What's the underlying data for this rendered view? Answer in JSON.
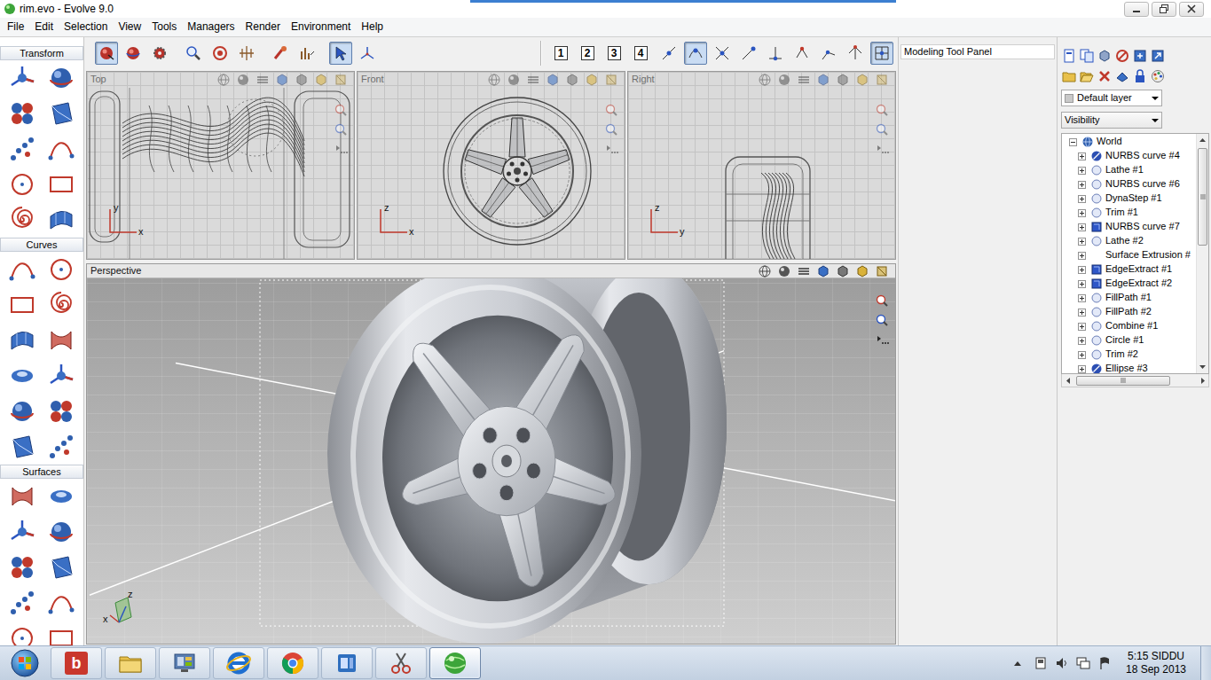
{
  "window": {
    "title": "rim.evo - Evolve 9.0"
  },
  "menu": [
    "File",
    "Edit",
    "Selection",
    "View",
    "Tools",
    "Managers",
    "Render",
    "Environment",
    "Help"
  ],
  "toolbar": {
    "tools": [
      {
        "selected": true
      },
      {
        "selected": false
      },
      {
        "selected": false
      },
      {
        "selected": false
      },
      {
        "selected": false
      },
      {
        "selected": false
      },
      {
        "selected": false
      },
      {
        "selected": false
      },
      {
        "selected": true
      },
      {
        "selected": false
      }
    ],
    "layouts": [
      {
        "label": "1",
        "selected": false
      },
      {
        "label": "2",
        "selected": false
      },
      {
        "label": "3",
        "selected": false
      },
      {
        "label": "4",
        "selected": false
      }
    ],
    "snaps": [
      {
        "selected": false
      },
      {
        "selected": true
      },
      {
        "selected": false
      },
      {
        "selected": false
      },
      {
        "selected": false
      },
      {
        "selected": false
      },
      {
        "selected": false
      },
      {
        "selected": false
      },
      {
        "selected": true
      }
    ]
  },
  "palette": [
    {
      "title": "Transform"
    },
    {
      "title": "Curves"
    },
    {
      "title": "Surfaces"
    }
  ],
  "viewports": [
    {
      "label": "Top",
      "axes": [
        "y",
        "x"
      ]
    },
    {
      "label": "Front",
      "axes": [
        "z",
        "x"
      ]
    },
    {
      "label": "Right",
      "axes": [
        "z",
        "y"
      ]
    },
    {
      "label": "Perspective",
      "axes": [
        "z",
        "x"
      ]
    }
  ],
  "tool_panel": {
    "title": "Modeling Tool Panel"
  },
  "objects": {
    "layer": "Default layer",
    "filter": "Visibility",
    "tree": {
      "label": "World",
      "expanded": true,
      "items": [
        {
          "label": "NURBS curve #4",
          "kind": "hidden"
        },
        {
          "label": "Lathe #1",
          "kind": "visible"
        },
        {
          "label": "NURBS curve #6",
          "kind": "visible"
        },
        {
          "label": "DynaStep #1",
          "kind": "visible"
        },
        {
          "label": "Trim #1",
          "kind": "visible"
        },
        {
          "label": "NURBS curve #7",
          "kind": "box"
        },
        {
          "label": "Lathe #2",
          "kind": "visible"
        },
        {
          "label": "Surface Extrusion #",
          "kind": "none"
        },
        {
          "label": "EdgeExtract #1",
          "kind": "box"
        },
        {
          "label": "EdgeExtract #2",
          "kind": "box"
        },
        {
          "label": "FillPath #1",
          "kind": "visible"
        },
        {
          "label": "FillPath #2",
          "kind": "visible"
        },
        {
          "label": "Combine #1",
          "kind": "visible"
        },
        {
          "label": "Circle #1",
          "kind": "visible"
        },
        {
          "label": "Trim #2",
          "kind": "visible"
        },
        {
          "label": "Ellipse #3",
          "kind": "hidden"
        }
      ]
    }
  },
  "taskbar": {
    "apps": [
      {
        "kind": "bing",
        "glyph": "b",
        "selected": false
      },
      {
        "kind": "folder",
        "selected": false
      },
      {
        "kind": "control",
        "selected": false
      },
      {
        "kind": "ie",
        "selected": false
      },
      {
        "kind": "chrome",
        "selected": false
      },
      {
        "kind": "office",
        "selected": false
      },
      {
        "kind": "snip",
        "selected": false
      },
      {
        "kind": "evolve",
        "selected": true
      }
    ],
    "clock": {
      "time": "5:15 SIDDU",
      "date": "18 Sep 2013"
    }
  }
}
